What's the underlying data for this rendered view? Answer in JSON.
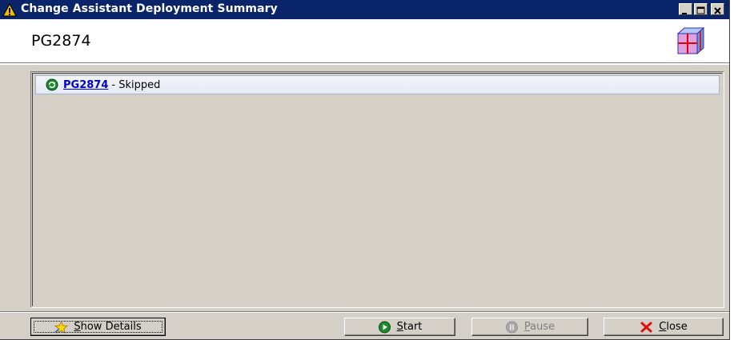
{
  "window": {
    "title": "Change Assistant Deployment Summary",
    "header_title": "PG2874"
  },
  "list": {
    "items": [
      {
        "link": "PG2874",
        "status": "- Skipped"
      }
    ]
  },
  "buttons": {
    "show_details": {
      "pre": "",
      "mnemonic": "S",
      "post": "how Details"
    },
    "start": {
      "pre": "",
      "mnemonic": "S",
      "post": "tart"
    },
    "pause": {
      "pre": "",
      "mnemonic": "P",
      "post": "ause"
    },
    "close": {
      "pre": "",
      "mnemonic": "C",
      "post": "lose"
    }
  },
  "colors": {
    "titlebar": "#0a246a",
    "link": "#0000cc",
    "face": "#d4d0c8"
  },
  "icons": {
    "title": "warning-triangle-icon",
    "logo": "cube-logo-icon",
    "row": "green-refresh-icon",
    "show_details": "star-icon",
    "start": "play-icon",
    "pause": "pause-icon",
    "close": "red-x-icon"
  }
}
